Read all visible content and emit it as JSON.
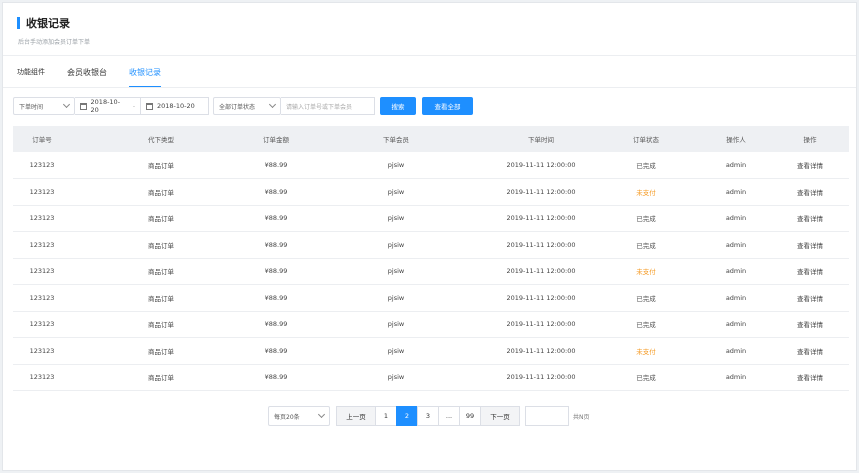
{
  "page": {
    "title": "收银记录",
    "subtitle": "后台手动添加会员订单下单"
  },
  "tabs": [
    {
      "label": "功能组件"
    },
    {
      "label": "会员收银台"
    },
    {
      "label": "收银记录"
    }
  ],
  "filters": {
    "time_type": "下单时间",
    "start_date": "2018-10-20",
    "separator": "-",
    "end_date": "2018-10-20",
    "status": "全部订单状态",
    "search_placeholder": "请输入订单号或下单会员",
    "search_label": "搜索",
    "view_all_label": "查看全部"
  },
  "table": {
    "headers": [
      "订单号",
      "代下类型",
      "订单金额",
      "下单会员",
      "下单时间",
      "订单状态",
      "操作人",
      "操作"
    ],
    "rows": [
      {
        "order_no": "123123",
        "type": "商品订单",
        "amount": "¥88.99",
        "member": "pjsiw",
        "time": "2019-11-11  12:00:00",
        "status": "已完成",
        "status_kind": "done",
        "operator": "admin",
        "action": "查看详情"
      },
      {
        "order_no": "123123",
        "type": "商品订单",
        "amount": "¥88.99",
        "member": "pjsiw",
        "time": "2019-11-11  12:00:00",
        "status": "未支付",
        "status_kind": "unpaid",
        "operator": "admin",
        "action": "查看详情"
      },
      {
        "order_no": "123123",
        "type": "商品订单",
        "amount": "¥88.99",
        "member": "pjsiw",
        "time": "2019-11-11  12:00:00",
        "status": "已完成",
        "status_kind": "done",
        "operator": "admin",
        "action": "查看详情"
      },
      {
        "order_no": "123123",
        "type": "商品订单",
        "amount": "¥88.99",
        "member": "pjsiw",
        "time": "2019-11-11  12:00:00",
        "status": "已完成",
        "status_kind": "done",
        "operator": "admin",
        "action": "查看详情"
      },
      {
        "order_no": "123123",
        "type": "商品订单",
        "amount": "¥88.99",
        "member": "pjsiw",
        "time": "2019-11-11  12:00:00",
        "status": "未支付",
        "status_kind": "unpaid",
        "operator": "admin",
        "action": "查看详情"
      },
      {
        "order_no": "123123",
        "type": "商品订单",
        "amount": "¥88.99",
        "member": "pjsiw",
        "time": "2019-11-11  12:00:00",
        "status": "已完成",
        "status_kind": "done",
        "operator": "admin",
        "action": "查看详情"
      },
      {
        "order_no": "123123",
        "type": "商品订单",
        "amount": "¥88.99",
        "member": "pjsiw",
        "time": "2019-11-11  12:00:00",
        "status": "已完成",
        "status_kind": "done",
        "operator": "admin",
        "action": "查看详情"
      },
      {
        "order_no": "123123",
        "type": "商品订单",
        "amount": "¥88.99",
        "member": "pjsiw",
        "time": "2019-11-11  12:00:00",
        "status": "未支付",
        "status_kind": "unpaid",
        "operator": "admin",
        "action": "查看详情"
      },
      {
        "order_no": "123123",
        "type": "商品订单",
        "amount": "¥88.99",
        "member": "pjsiw",
        "time": "2019-11-11  12:00:00",
        "status": "已完成",
        "status_kind": "done",
        "operator": "admin",
        "action": "查看详情"
      }
    ]
  },
  "pagination": {
    "page_size": "每页20条",
    "prev": "上一页",
    "pages": [
      "1",
      "2",
      "3",
      "...",
      "99"
    ],
    "current": "2",
    "next": "下一页",
    "jump_value": "",
    "total": "共N页"
  },
  "colors": {
    "accent": "#1e8fff",
    "unpaid": "#f59a23"
  }
}
